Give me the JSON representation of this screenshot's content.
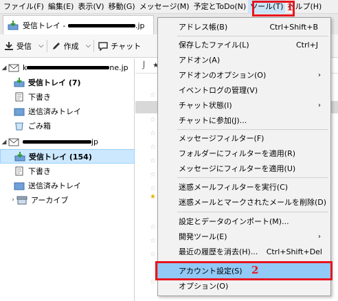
{
  "menubar": {
    "items": [
      "ファイル(F)",
      "編集(E)",
      "表示(V)",
      "移動(G)",
      "メッセージ(M)",
      "予定とToDo(N)",
      "ツール(T)",
      "ヘルプ(H)"
    ]
  },
  "tab": {
    "title_prefix": "受信トレイ - ",
    "title_suffix": ".jp"
  },
  "toolbar": {
    "receive": "受信",
    "compose": "作成",
    "chat": "チャット"
  },
  "folders": {
    "account1_suffix": "ne.jp",
    "account1_prefix": "k",
    "account2_suffix": "jp",
    "items": [
      {
        "label": "受信トレイ (7)"
      },
      {
        "label": "下書き"
      },
      {
        "label": "送信済みトレイ"
      },
      {
        "label": "ごみ箱"
      },
      {
        "label": "受信トレイ (154)"
      },
      {
        "label": "下書き"
      },
      {
        "label": "送信済みトレイ"
      },
      {
        "label": "アーカイブ"
      }
    ]
  },
  "dropdown": {
    "items": [
      {
        "label": "アドレス帳(B)",
        "shortcut": "Ctrl+Shift+B"
      },
      {
        "label": "保存したファイル(L)",
        "shortcut": "Ctrl+J"
      },
      {
        "label": "アドオン(A)",
        "shortcut": ""
      },
      {
        "label": "アドオンのオプション(O)",
        "shortcut": ""
      },
      {
        "label": "イベントログの管理(V)",
        "shortcut": ""
      },
      {
        "label": "チャット状態(I)",
        "shortcut": ""
      },
      {
        "label": "チャットに参加(J)...",
        "shortcut": ""
      },
      {
        "label": "メッセージフィルター(F)",
        "shortcut": ""
      },
      {
        "label": "フォルダーにフィルターを適用(R)",
        "shortcut": ""
      },
      {
        "label": "メッセージにフィルターを適用(U)",
        "shortcut": ""
      },
      {
        "label": "迷惑メールフィルターを実行(C)",
        "shortcut": ""
      },
      {
        "label": "迷惑メールとマークされたメールを削除(D)",
        "shortcut": ""
      },
      {
        "label": "設定とデータのインポート(M)...",
        "shortcut": ""
      },
      {
        "label": "開発ツール(E)",
        "shortcut": ""
      },
      {
        "label": "最近の履歴を消去(H)...",
        "shortcut": "Ctrl+Shift+Del"
      },
      {
        "label": "アカウント設定(S)",
        "shortcut": ""
      },
      {
        "label": "オプション(O)",
        "shortcut": ""
      }
    ]
  },
  "annotations": {
    "step1": "1",
    "step2": "2"
  },
  "colors": {
    "highlight": "#91c9f7",
    "selected_folder": "#cce8ff",
    "annotation_red": "#e8141e"
  }
}
